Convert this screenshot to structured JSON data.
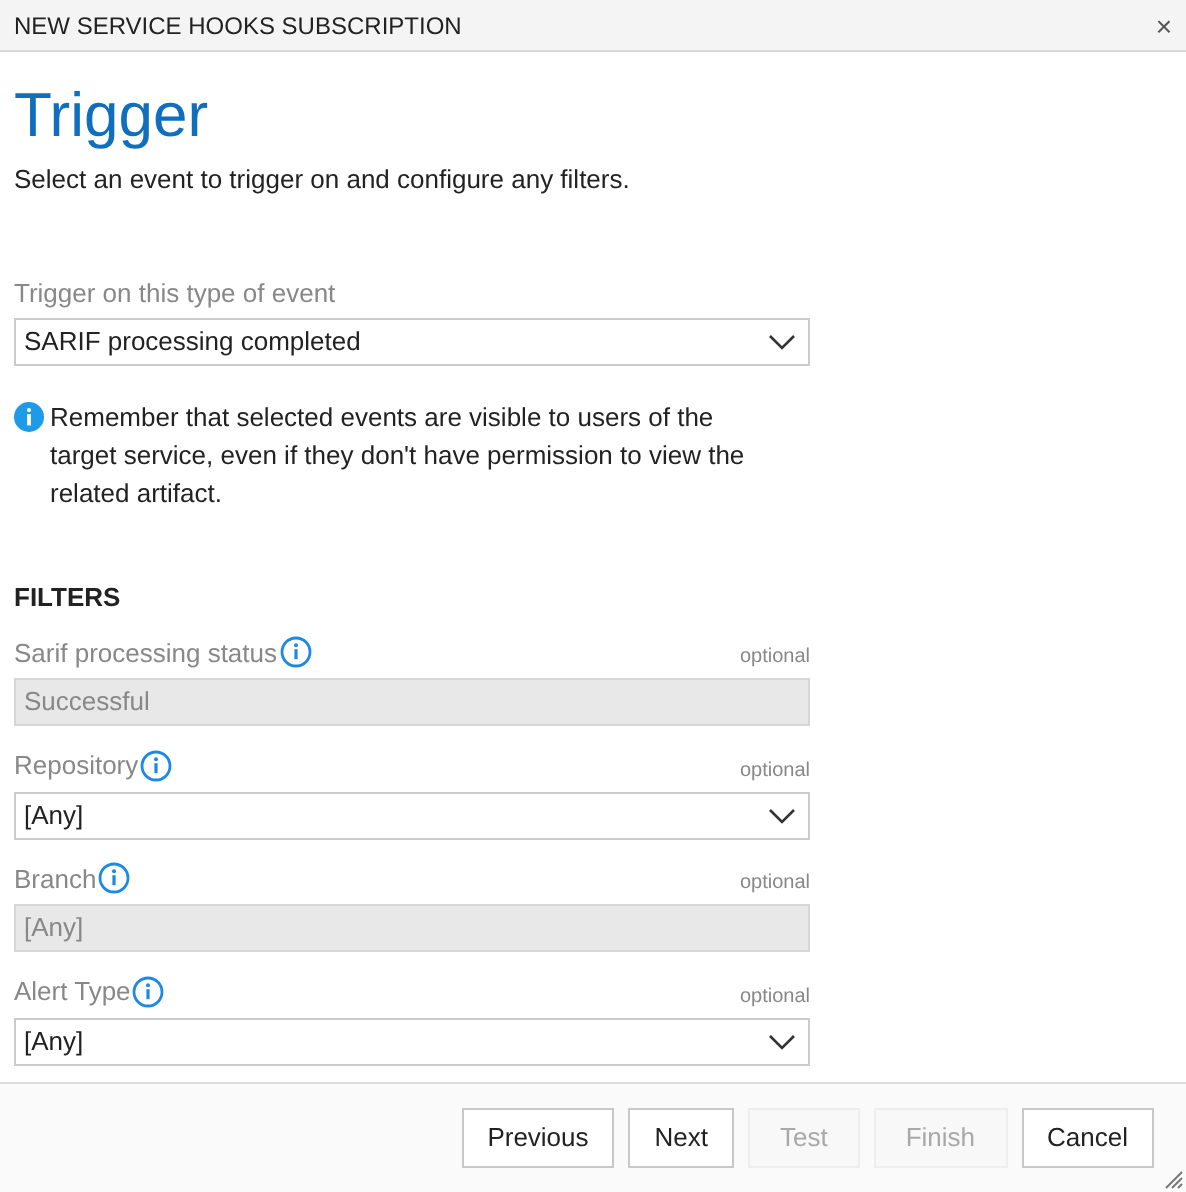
{
  "window": {
    "title": "NEW SERVICE HOOKS SUBSCRIPTION",
    "close": "×"
  },
  "heading": "Trigger",
  "subtitle": "Select an event to trigger on and configure any filters.",
  "event": {
    "label": "Trigger on this type of event",
    "value": "SARIF processing completed"
  },
  "notice": "Remember that selected events are visible to users of the target service, even if they don't have permission to view the related artifact.",
  "filters_heading": "FILTERS",
  "filters": [
    {
      "label": "Sarif processing status",
      "optional": "optional",
      "value": "Successful",
      "disabled": true
    },
    {
      "label": "Repository",
      "optional": "optional",
      "value": "[Any]",
      "disabled": false
    },
    {
      "label": "Branch",
      "optional": "optional",
      "value": "[Any]",
      "disabled": true
    },
    {
      "label": "Alert Type",
      "optional": "optional",
      "value": "[Any]",
      "disabled": false
    }
  ],
  "buttons": [
    {
      "label": "Previous",
      "disabled": false
    },
    {
      "label": "Next",
      "disabled": false
    },
    {
      "label": "Test",
      "disabled": true
    },
    {
      "label": "Finish",
      "disabled": true
    },
    {
      "label": "Cancel",
      "disabled": false
    }
  ]
}
